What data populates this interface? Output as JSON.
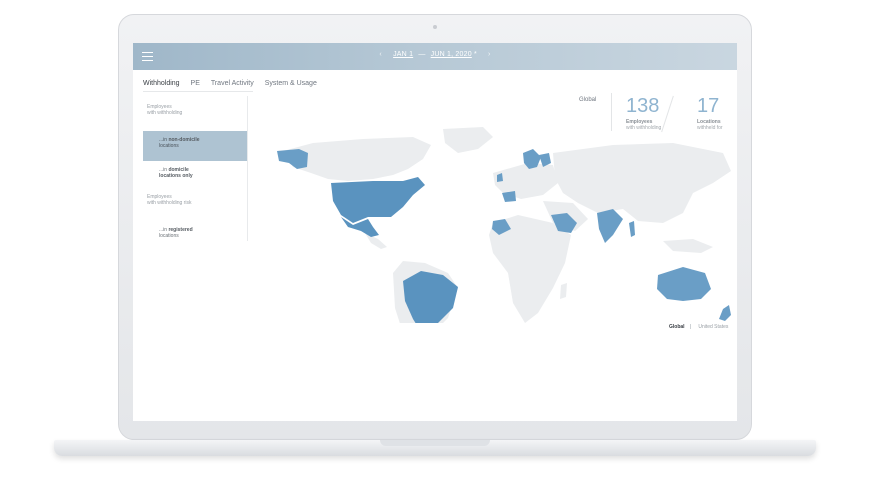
{
  "header": {
    "date_start": "JAN 1",
    "date_sep": "—",
    "date_end": "JUN 1, 2020",
    "dropdown_marker": "*",
    "prev_arrow": "‹",
    "next_arrow": "›"
  },
  "tabs": [
    {
      "label": "Withholding",
      "active": true
    },
    {
      "label": "PE",
      "active": false
    },
    {
      "label": "Travel Activity",
      "active": false
    },
    {
      "label": "System & Usage",
      "active": false
    }
  ],
  "sidebar": {
    "group1": {
      "line1": "Employees",
      "line2": "with withholding"
    },
    "item1": {
      "prefix": "...in ",
      "bold": "non-domicile",
      "line2": "locations",
      "active": true
    },
    "item2": {
      "prefix": "...in ",
      "bold": "domicile",
      "line2": "locations only",
      "active": false
    },
    "group2": {
      "line1": "Employees",
      "line2": "with withholding risk"
    },
    "item3": {
      "prefix": "...in ",
      "bold": "registered",
      "line2": "locations",
      "active": false
    }
  },
  "map": {
    "scope_label": "Global",
    "land_color": "#ebedef",
    "highlight_color": "#6a9ec6",
    "highlight_strong_color": "#5a93bf",
    "highlighted_regions": [
      "Alaska",
      "United States",
      "Mexico",
      "Brazil",
      "Morocco",
      "Ireland",
      "Spain",
      "Scandinavia",
      "Saudi Arabia",
      "India",
      "Thailand",
      "Australia",
      "New Zealand"
    ]
  },
  "kpis": [
    {
      "value": "138",
      "label1": "Employees",
      "label2": "with withholding"
    },
    {
      "value": "17",
      "label1": "Locations",
      "label2": "withheld for"
    }
  ],
  "scope_toggle": {
    "options": [
      {
        "label": "Global",
        "selected": true
      },
      {
        "label": "United States",
        "selected": false
      }
    ]
  }
}
